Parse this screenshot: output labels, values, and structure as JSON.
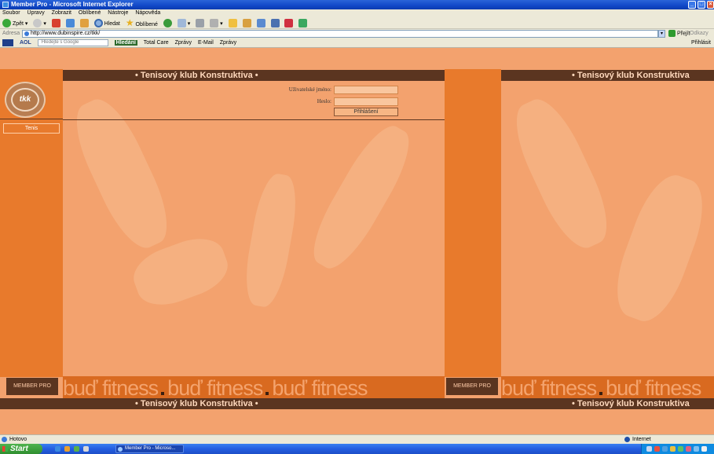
{
  "window": {
    "title": "Member Pro - Microsoft Internet Explorer"
  },
  "menu": [
    "Soubor",
    "Úpravy",
    "Zobrazit",
    "Oblíbené",
    "Nástroje",
    "Nápověda"
  ],
  "toolbar": {
    "back_label": "Zpět",
    "search_label": "Hledat",
    "favorites_label": "Oblíbené"
  },
  "address": {
    "label": "Adresa",
    "url": "http://www.dubinspire.cz/tkk/",
    "go_label": "Přejít",
    "links_label": "Odkazy"
  },
  "aolbar": {
    "brand": "AOL",
    "search_hint": "Hledejte s Google",
    "hledani": "Hledání",
    "total_care": "Total Care",
    "zpravy1": "Zprávy",
    "email": "E-Mail",
    "zpravy2": "Zprávy",
    "login": "Přihlásit"
  },
  "site": {
    "header_title": "Tenisový klub Konstruktiva",
    "logo_text": "tkk",
    "nav_item": "Tenis",
    "username_label": "Uživatelské jméno:",
    "password_label": "Heslo:",
    "login_button": "Přihlášení",
    "footer_brand": "MEMBER PRO",
    "slogan": "buď fitness"
  },
  "status": {
    "text": "Hotovo",
    "zone": "Internet"
  },
  "taskbar": {
    "start": "Start",
    "window_item": "Member Pro - Microso..."
  }
}
